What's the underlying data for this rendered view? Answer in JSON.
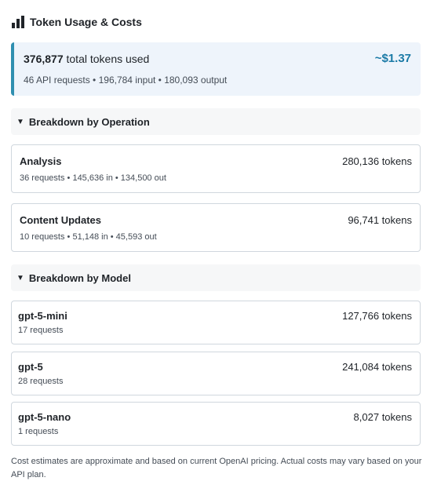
{
  "header": {
    "icon": "bar-chart-icon",
    "title": "Token Usage & Costs"
  },
  "summary": {
    "total_tokens": "376,877",
    "total_label": "total tokens used",
    "cost": "~$1.37",
    "detail": "46 API requests • 196,784 input • 180,093 output",
    "accent_color": "#2f8fb0"
  },
  "operations": {
    "caret": "▼",
    "title": "Breakdown by Operation",
    "items": [
      {
        "name": "Analysis",
        "tokens": "280,136 tokens",
        "detail": "36 requests • 145,636 in • 134,500 out"
      },
      {
        "name": "Content Updates",
        "tokens": "96,741 tokens",
        "detail": "10 requests • 51,148 in • 45,593 out"
      }
    ]
  },
  "models": {
    "caret": "▼",
    "title": "Breakdown by Model",
    "items": [
      {
        "name": "gpt-5-mini",
        "tokens": "127,766 tokens",
        "detail": "17 requests"
      },
      {
        "name": "gpt-5",
        "tokens": "241,084 tokens",
        "detail": "28 requests"
      },
      {
        "name": "gpt-5-nano",
        "tokens": "8,027 tokens",
        "detail": "1 requests"
      }
    ]
  },
  "footnote": "Cost estimates are approximate and based on current OpenAI pricing. Actual costs may vary based on your API plan."
}
